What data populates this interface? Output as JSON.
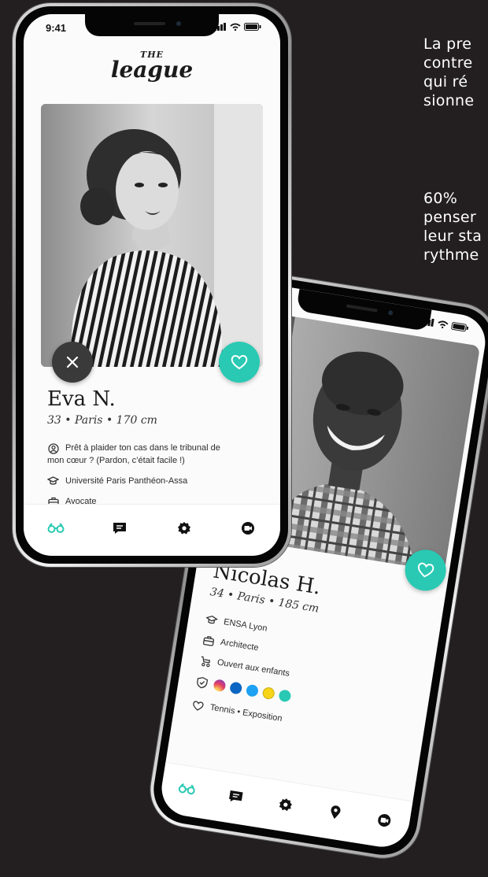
{
  "background_text": {
    "para1": [
      "La pre",
      "contre",
      "qui  ré",
      "sionne"
    ],
    "para2": [
      "60%",
      "penser",
      "leur sta",
      "rythme"
    ]
  },
  "colors": {
    "accent": "#29c9b3",
    "dark_button": "#3a3a3a",
    "page_bg": "#231f20"
  },
  "phone1": {
    "status_time": "9:41",
    "logo_the": "THE",
    "logo_league": "league",
    "profile": {
      "name": "Eva N.",
      "age": "33",
      "city": "Paris",
      "height": "170 cm",
      "separator": "•",
      "prompt_line1": "Prêt à plaider ton cas dans le tribunal de",
      "prompt_line2": "mon cœur ? (Pardon, c’était facile !)",
      "education": "Université Paris Panthéon-Assa",
      "job": "Avocate"
    },
    "tabs": [
      "binoculars-icon",
      "chat-icon",
      "gear-icon",
      "video-icon"
    ]
  },
  "phone2": {
    "profile": {
      "name": "Nicolas H.",
      "age": "34",
      "city": "Paris",
      "height": "185 cm",
      "separator": "•",
      "education": "ENSA Lyon",
      "job": "Architecte",
      "children": "Ouvert aux enfants",
      "socials": [
        "instagram-icon",
        "linkedin-icon",
        "twitter-icon",
        "snapchat-icon",
        "messenger-icon"
      ],
      "interest1": "Tennis",
      "interest2": "Exposition"
    },
    "tabs": [
      "binoculars-icon",
      "chat-icon",
      "gear-icon",
      "location-pin-icon",
      "video-icon"
    ]
  }
}
